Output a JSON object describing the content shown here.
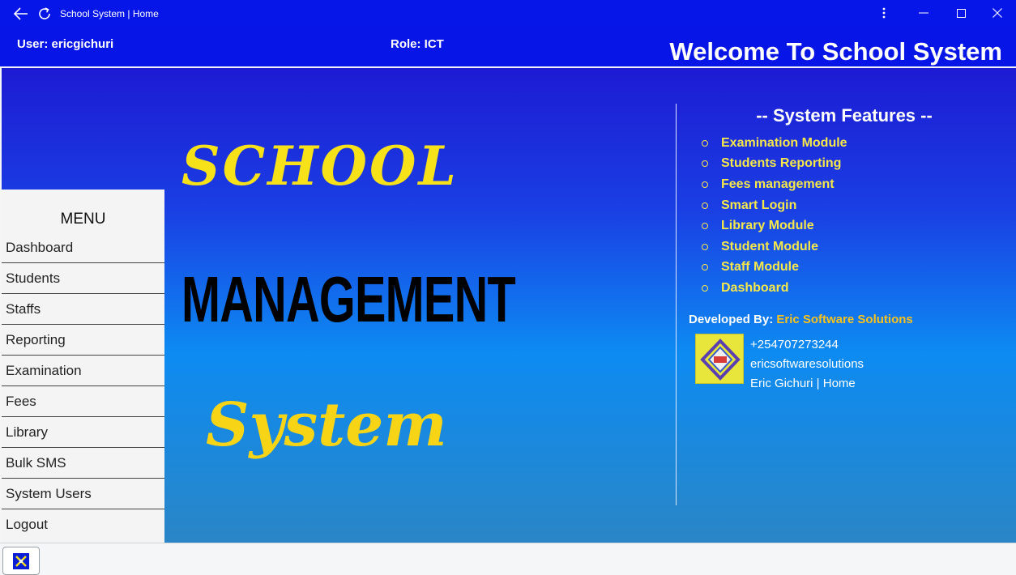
{
  "window": {
    "title": "School System | Home",
    "icons": [
      "back-arrow-icon",
      "refresh-icon",
      "more-vert-icon",
      "minimize-icon",
      "maximize-icon",
      "close-icon"
    ]
  },
  "header": {
    "user": "User: ericgichuri",
    "role": "Role: ICT",
    "welcome": "Welcome To School System"
  },
  "logo": {
    "line1": "SCHOOL",
    "line2": "MANAGEMENT",
    "line3": "System"
  },
  "menu": {
    "title": "MENU",
    "items": [
      "Dashboard",
      "Students",
      "Staffs",
      "Reporting",
      "Examination",
      "Fees",
      "Library",
      "Bulk SMS",
      "System Users",
      "Logout"
    ]
  },
  "features": {
    "title": "-- System Features --",
    "items": [
      "Examination Module",
      "Students Reporting",
      "Fees management",
      "Smart Login",
      "Library Module",
      "Student Module",
      "Staff Module",
      "Dashboard"
    ]
  },
  "developer": {
    "label": "Developed By:",
    "name": "Eric Software Solutions",
    "phone": "+254707273244",
    "handle": "ericsoftwaresolutions",
    "link": "Eric Gichuri | Home"
  },
  "colors": {
    "titlebar": "#0716e8",
    "feature_text": "#f7e84a",
    "developer_name": "#f9c21c",
    "logo_yellow": "#f7e21a"
  },
  "taskbar": {
    "app_icon": "school-app-icon"
  }
}
